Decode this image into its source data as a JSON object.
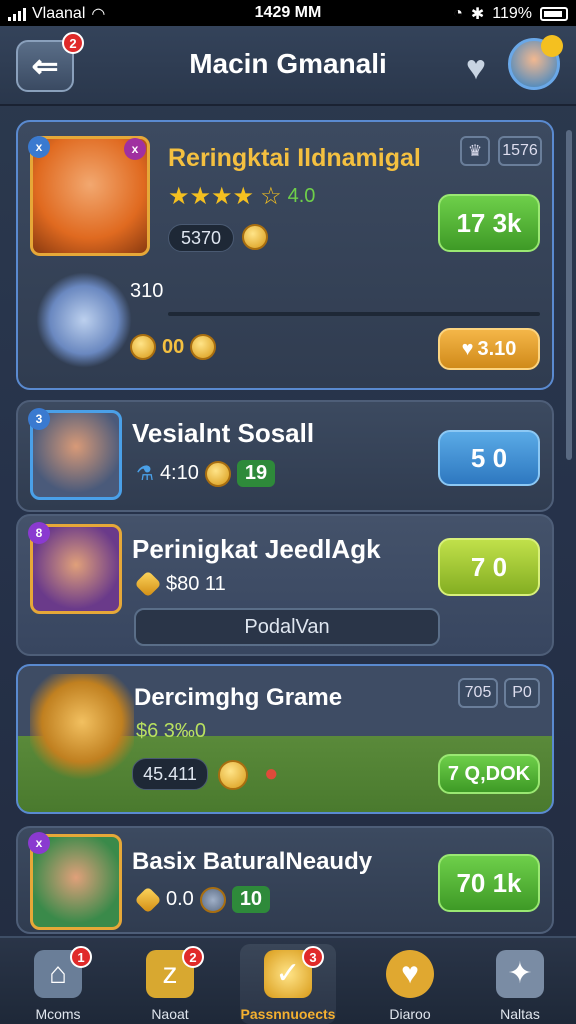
{
  "status": {
    "carrier": "Vlaanal",
    "time": "1429 MM",
    "battery": "119%"
  },
  "header": {
    "title": "Macin Gmanali",
    "back_badge": "2"
  },
  "cards": [
    {
      "name": "Reringktai Ildnamigal",
      "rating": "4.0",
      "pill": "5370",
      "button": "17 3k",
      "box1": "1576",
      "progress_label": "310",
      "stat": "00",
      "orange_button": "3.10"
    },
    {
      "name": "Vesialnt Sosall",
      "stat1": "4:10",
      "stat2": "19",
      "button": "5 0"
    },
    {
      "name": "Perinigkat JeedlAgk",
      "stat": "$80 11",
      "button": "7 0",
      "input_placeholder": "PodalVan"
    },
    {
      "name": "Dercimghg Grame",
      "stat": "$6 3‰0",
      "pill": "45.411",
      "button": "7 Q,DOK",
      "box1": "705",
      "box2": "P0"
    },
    {
      "name": "Basix BaturalNeaudy",
      "stat1": "0.0",
      "stat2": "10",
      "button": "70 1k"
    }
  ],
  "nav": [
    {
      "label": "Mcoms",
      "badge": "1"
    },
    {
      "label": "Naoat",
      "badge": "2"
    },
    {
      "label": "Passnnuoects",
      "badge": "3",
      "active": true
    },
    {
      "label": "Diaroo"
    },
    {
      "label": "Naltas"
    }
  ],
  "icons": {
    "back": "back-arrow-icon",
    "heart": "heart-icon",
    "home": "home-icon",
    "gem": "gem-icon",
    "coin": "coin-icon",
    "shield": "shield-icon",
    "puzzle": "puzzle-icon"
  },
  "colors": {
    "accent": "#6ecf4a",
    "gold": "#f4c020",
    "active_nav": "#f4b030",
    "badge": "#e02a2a"
  }
}
